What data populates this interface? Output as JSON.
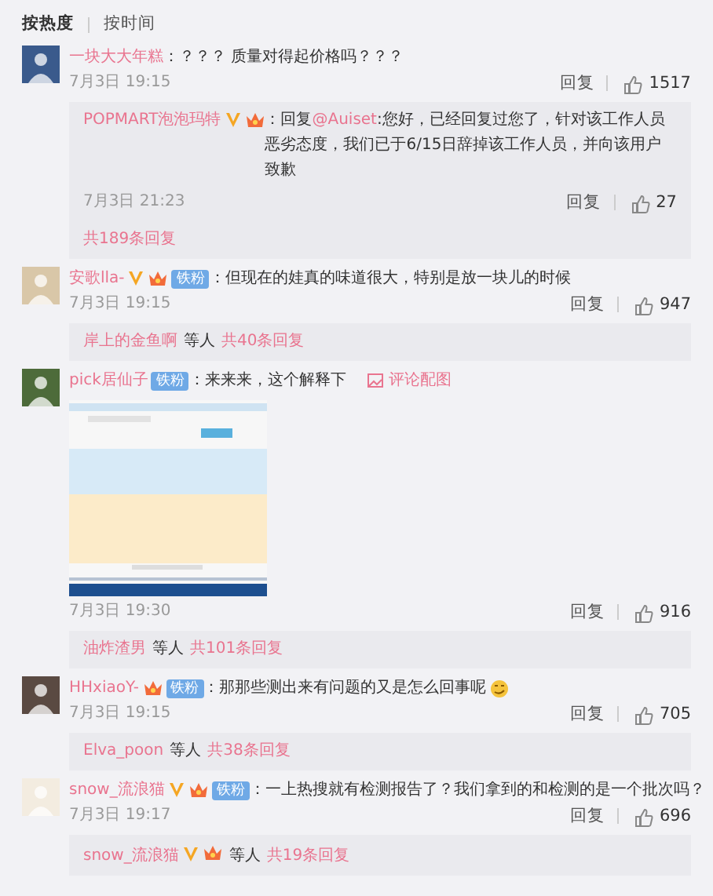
{
  "sort_tabs": [
    {
      "label": "按热度",
      "selected": true
    },
    {
      "label": "按时间",
      "selected": false
    }
  ],
  "comments": [
    {
      "author": "一块大大年糕",
      "text": "：？？？ 质量对得起价格吗？？？",
      "time": "7月3日 19:15",
      "reply_label": "回复",
      "likes": "1517",
      "replies": {
        "kind": "thread",
        "items": [
          {
            "author": "POPMART泡泡玛特",
            "badges": [
              {
                "kind": "verified"
              },
              {
                "kind": "vip"
              }
            ],
            "prefix": "：回复",
            "mention": "@Auiset",
            "text": ":您好，已经回复过您了，针对该工作人员恶劣态度，我们已于6/15日辞掉该工作人员，并向该用户致歉",
            "time": "7月3日 21:23",
            "reply_label": "回复",
            "likes": "27"
          }
        ],
        "total": "共189条回复"
      }
    },
    {
      "author": "安歌lla-",
      "badges": [
        {
          "kind": "verified"
        },
        {
          "kind": "vip"
        },
        {
          "kind": "fan",
          "label": "铁粉"
        }
      ],
      "text": "：但现在的娃真的味道很大，特别是放一块儿的时候",
      "time": "7月3日 19:15",
      "reply_label": "回复",
      "likes": "947",
      "replies": {
        "kind": "summary",
        "names": [
          "岸上的金鱼啊"
        ],
        "joiner": "等人",
        "total": "共40条回复"
      }
    },
    {
      "author": "pick居仙子",
      "badges": [
        {
          "kind": "fan",
          "label": "铁粉"
        }
      ],
      "text": "：来来来，这个解释下",
      "image_link": "评论配图",
      "image": {
        "kind": "picture"
      },
      "time": "7月3日 19:30",
      "reply_label": "回复",
      "likes": "916",
      "replies": {
        "kind": "summary",
        "names": [
          "油炸渣男"
        ],
        "joiner": "等人",
        "total": "共101条回复"
      }
    },
    {
      "author": "HHxiaoY-",
      "badges": [
        {
          "kind": "vip"
        },
        {
          "kind": "fan",
          "label": "铁粉"
        }
      ],
      "text": "：那那些测出来有问题的又是怎么回事呢",
      "emoji": true,
      "time": "7月3日 19:15",
      "reply_label": "回复",
      "likes": "705",
      "replies": {
        "kind": "summary",
        "names": [
          "Elva_poon"
        ],
        "joiner": "等人",
        "total": "共38条回复"
      }
    },
    {
      "author": "snow_流浪猫",
      "badges": [
        {
          "kind": "verified"
        },
        {
          "kind": "vip"
        },
        {
          "kind": "fan",
          "label": "铁粉"
        }
      ],
      "text": "：一上热搜就有检测报告了？我们拿到的和检测的是一个批次吗？",
      "time": "7月3日 19:17",
      "reply_label": "回复",
      "likes": "696",
      "replies": {
        "kind": "summary",
        "names": [
          "snow_流浪猫"
        ],
        "name_badges": [
          {
            "kind": "verified"
          },
          {
            "kind": "vip"
          }
        ],
        "joiner": "等人",
        "total": "共19条回复"
      }
    }
  ]
}
